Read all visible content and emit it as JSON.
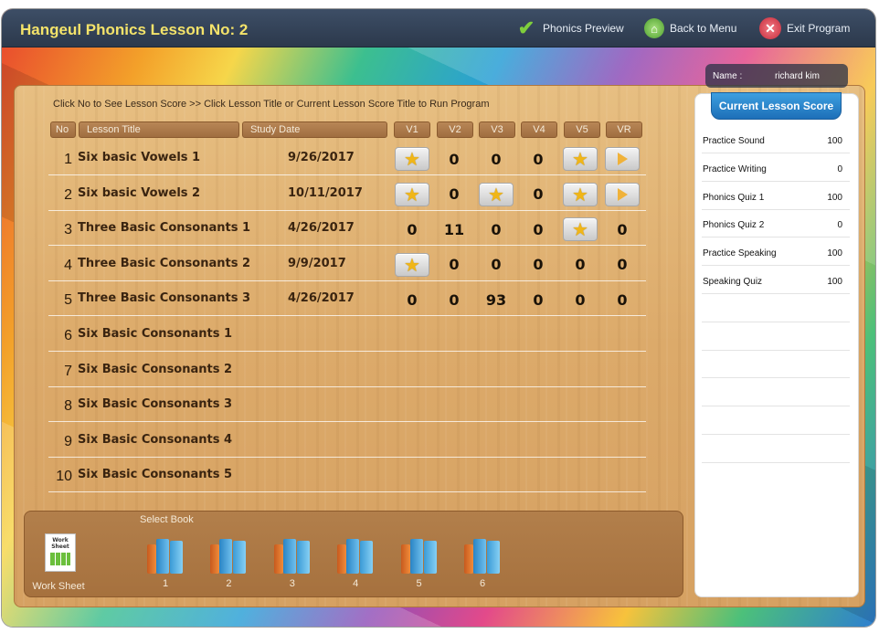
{
  "window": {
    "title": "Hangeul Phonics Lesson No: 2",
    "phonics_preview": "Phonics Preview",
    "back_to_menu": "Back to Menu",
    "exit_program": "Exit Program"
  },
  "user": {
    "name_label": "Name :",
    "name": "richard kim"
  },
  "instruction": "Click No to See Lesson Score >> Click Lesson Title or Current Lesson Score Title to Run Program",
  "table": {
    "headers": [
      "No",
      "Lesson Title",
      "Study Date",
      "V1",
      "V2",
      "V3",
      "V4",
      "V5",
      "VR"
    ],
    "rows": [
      {
        "no": "1",
        "title": "Six basic Vowels 1",
        "date": "9/26/2017",
        "v": [
          "star",
          "0",
          "0",
          "0",
          "star",
          "play"
        ]
      },
      {
        "no": "2",
        "title": "Six basic Vowels 2",
        "date": "10/11/2017",
        "v": [
          "star",
          "0",
          "star",
          "0",
          "star",
          "play"
        ]
      },
      {
        "no": "3",
        "title": "Three Basic Consonants 1",
        "date": "4/26/2017",
        "v": [
          "0",
          "11",
          "0",
          "0",
          "star",
          "0"
        ]
      },
      {
        "no": "4",
        "title": "Three Basic Consonants 2",
        "date": "9/9/2017",
        "v": [
          "star",
          "0",
          "0",
          "0",
          "0",
          "0"
        ]
      },
      {
        "no": "5",
        "title": "Three Basic Consonants 3",
        "date": "4/26/2017",
        "v": [
          "0",
          "0",
          "93",
          "0",
          "0",
          "0"
        ]
      },
      {
        "no": "6",
        "title": "Six Basic Consonants 1",
        "date": "",
        "v": []
      },
      {
        "no": "7",
        "title": "Six Basic Consonants 2",
        "date": "",
        "v": []
      },
      {
        "no": "8",
        "title": "Six Basic Consonants 3",
        "date": "",
        "v": []
      },
      {
        "no": "9",
        "title": "Six Basic Consonants 4",
        "date": "",
        "v": []
      },
      {
        "no": "10",
        "title": "Six Basic Consonants 5",
        "date": "",
        "v": []
      }
    ]
  },
  "score_panel": {
    "title": "Current Lesson Score",
    "items": [
      {
        "label": "Practice Sound",
        "value": "100"
      },
      {
        "label": "Practice Writing",
        "value": "0"
      },
      {
        "label": "Phonics Quiz 1",
        "value": "100"
      },
      {
        "label": "Phonics Quiz 2",
        "value": "0"
      },
      {
        "label": "Practice Speaking",
        "value": "100"
      },
      {
        "label": "Speaking Quiz",
        "value": "100"
      },
      {
        "label": "",
        "value": ""
      },
      {
        "label": "",
        "value": ""
      },
      {
        "label": "",
        "value": ""
      },
      {
        "label": "",
        "value": ""
      },
      {
        "label": "",
        "value": ""
      },
      {
        "label": "",
        "value": ""
      }
    ]
  },
  "bottom": {
    "worksheet_label": "Work Sheet",
    "worksheet_icon_text": "Work Sheet",
    "select_book_label": "Select Book",
    "books": [
      "1",
      "2",
      "3",
      "4",
      "5",
      "6"
    ]
  },
  "colors": {
    "title_yellow": "#f4e36a",
    "score_blue": "#1d6fb8",
    "star": "#f0b618"
  }
}
